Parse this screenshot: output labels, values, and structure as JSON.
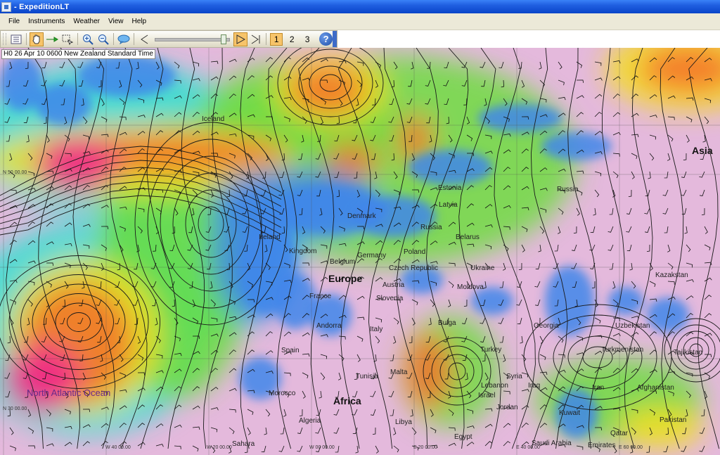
{
  "window": {
    "title": "- ExpeditionLT",
    "app_icon": "app-icon"
  },
  "menubar": {
    "items": [
      "File",
      "Instruments",
      "Weather",
      "View",
      "Help"
    ]
  },
  "toolbar": {
    "buttons": [
      {
        "name": "list-icon",
        "active": false
      },
      {
        "name": "hand-icon",
        "active": true
      },
      {
        "name": "arrow-icon",
        "active": false
      },
      {
        "name": "select-rect-icon",
        "active": false
      },
      {
        "name": "zoom-in-icon",
        "active": false
      },
      {
        "name": "zoom-out-icon",
        "active": false
      },
      {
        "name": "wind-icon",
        "active": false
      }
    ],
    "play_controls": [
      "step-back-icon",
      "play-icon",
      "step-forward-icon"
    ],
    "slider_position": 0.95,
    "pages": [
      "1",
      "2",
      "3"
    ],
    "active_page": "1",
    "help_label": "?"
  },
  "map": {
    "time_label": "H0 26 Apr 10 0600 New Zealand Standard Time",
    "labels": {
      "iceland": "Iceland",
      "ireland": "Ireland",
      "kingdom": "Kingdom",
      "belgium": "Belgium",
      "denmark": "Denmark",
      "germany": "Germany",
      "poland": "Poland",
      "czech": "Czech Republic",
      "austria": "Austria",
      "slovenia": "Slovenia",
      "france": "France",
      "andorra": "Andorra",
      "italy": "Italy",
      "spain": "Spain",
      "tunisia": "Tunisia",
      "malta": "Malta",
      "morocco": "Morocco",
      "algeria": "Algeria",
      "sahara": "Sahara",
      "libya": "Libya",
      "egypt": "Egypt",
      "estonia": "Estonia",
      "latvia": "Latvia",
      "russia_w": "Russia",
      "russia_e": "Russia",
      "belarus": "Belarus",
      "ukraine": "Ukraine",
      "moldova": "Moldova",
      "bulgaria": "Bulga",
      "turkey": "Turkey",
      "georgia": "Georgia",
      "syria": "Syria",
      "lebanon": "Lebanon",
      "israel": "Israel",
      "jordan": "Jordan",
      "iraq": "Iraq",
      "iran": "Iran",
      "kuwait": "Kuwait",
      "saudi": "Saudi Arabia",
      "uzbekistan": "Uzbekistan",
      "turkmenistan": "Turkmenistan",
      "tajikistan": "Tajikistan",
      "afghanistan": "Afghanistan",
      "pakistan": "Pakistan",
      "kazakhstan": "Kazakstan",
      "qatar": "Qatar",
      "emirates": "Emirates",
      "europe": "Europe",
      "africa": "Africa",
      "asia": "Asia",
      "ocean": "North Atlantic Ocean",
      "grid_n50": "N 50 00.00",
      "grid_n30": "N 30 00.00",
      "grid_w40": "W 40 00.00",
      "grid_w20": "W 20 00.00",
      "grid_w0": "W 00 00.00",
      "grid_e20": "E 20 00.00",
      "grid_e40": "E 40 00.00",
      "grid_e60": "E 60 00.00"
    },
    "colors": {
      "calm": "#e4b9dc",
      "light": "#3f86ea",
      "moderate": "#30e0d0",
      "fresh": "#6fdc40",
      "strong": "#f3e020",
      "gale": "#f5702a",
      "storm": "#f02090",
      "isobar": "#1a1a1a"
    }
  }
}
